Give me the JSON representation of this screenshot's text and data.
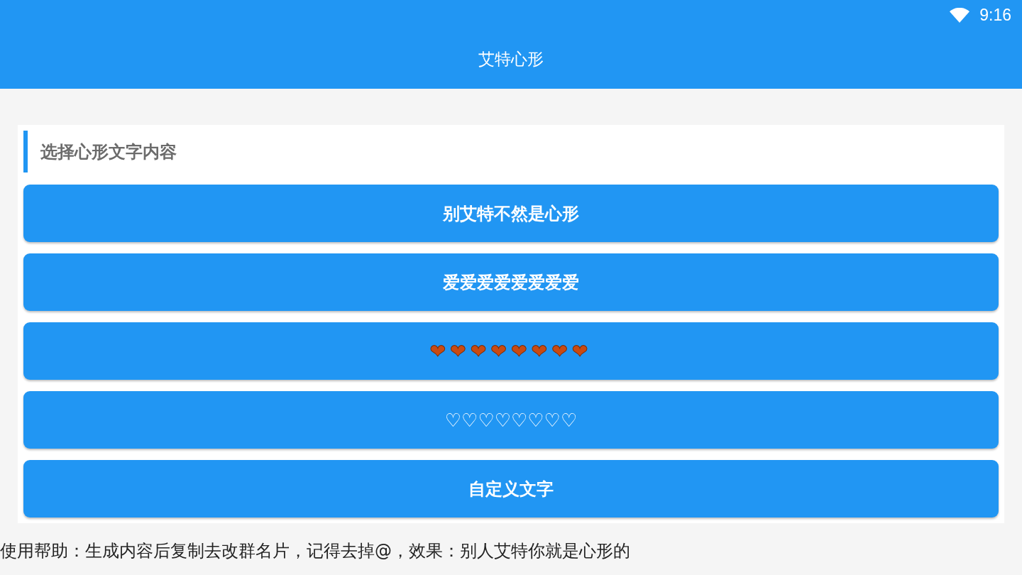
{
  "status_bar": {
    "time": "9:16"
  },
  "app_bar": {
    "title": "艾特心形"
  },
  "section": {
    "title": "选择心形文字内容",
    "options": [
      {
        "kind": "text",
        "label": "别艾特不然是心形"
      },
      {
        "kind": "text",
        "label": "爱爱爱爱爱爱爱爱"
      },
      {
        "kind": "emoji",
        "label": "❤❤❤❤❤❤❤❤"
      },
      {
        "kind": "symbol",
        "label": "♡♡♡♡♡♡♡♡"
      },
      {
        "kind": "text",
        "label": "自定义文字"
      }
    ]
  },
  "help_text": "使用帮助：生成内容后复制去改群名片，记得去掉@，效果：别人艾特你就是心形的"
}
